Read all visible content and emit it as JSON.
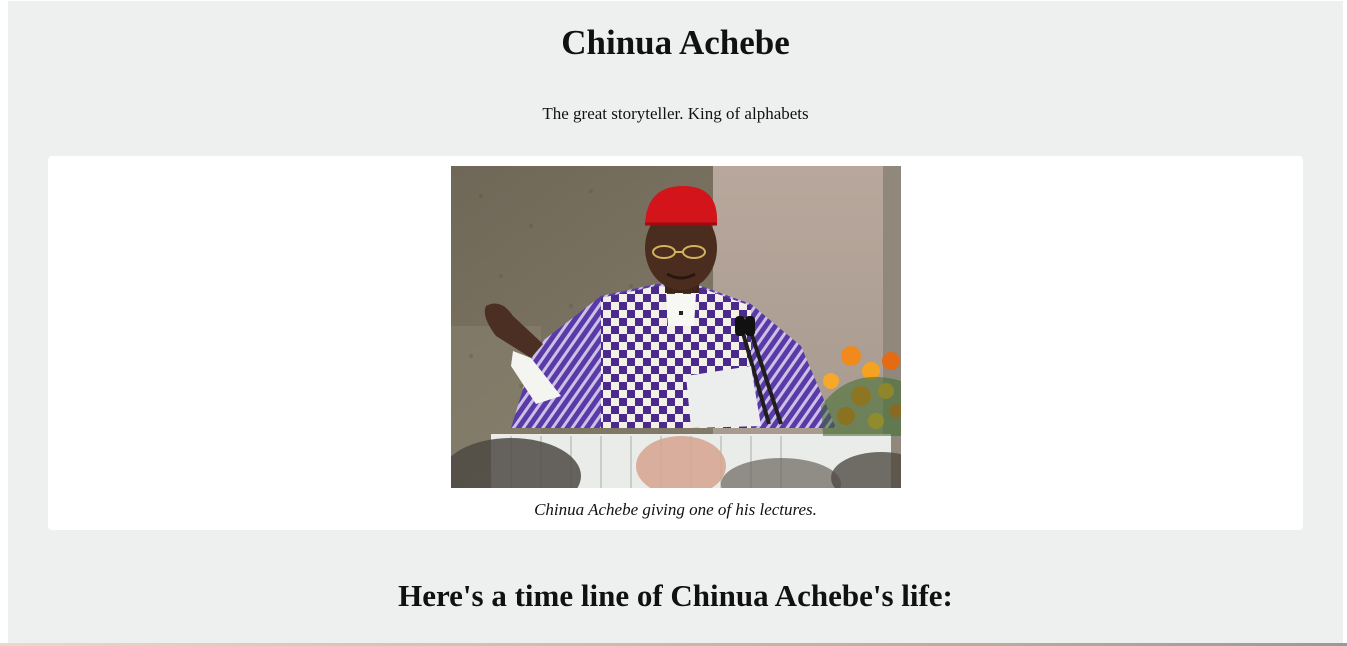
{
  "header": {
    "title": "Chinua Achebe",
    "tagline": "The great storyteller. King of alphabets"
  },
  "figure": {
    "image_icon": "portrait-photo",
    "caption": "Chinua Achebe giving one of his lectures."
  },
  "timeline": {
    "heading": "Here's a time line of Chinua Achebe's life:"
  },
  "colors": {
    "page_background": "#eef0ef",
    "card_background": "#ffffff",
    "text": "#111111"
  }
}
